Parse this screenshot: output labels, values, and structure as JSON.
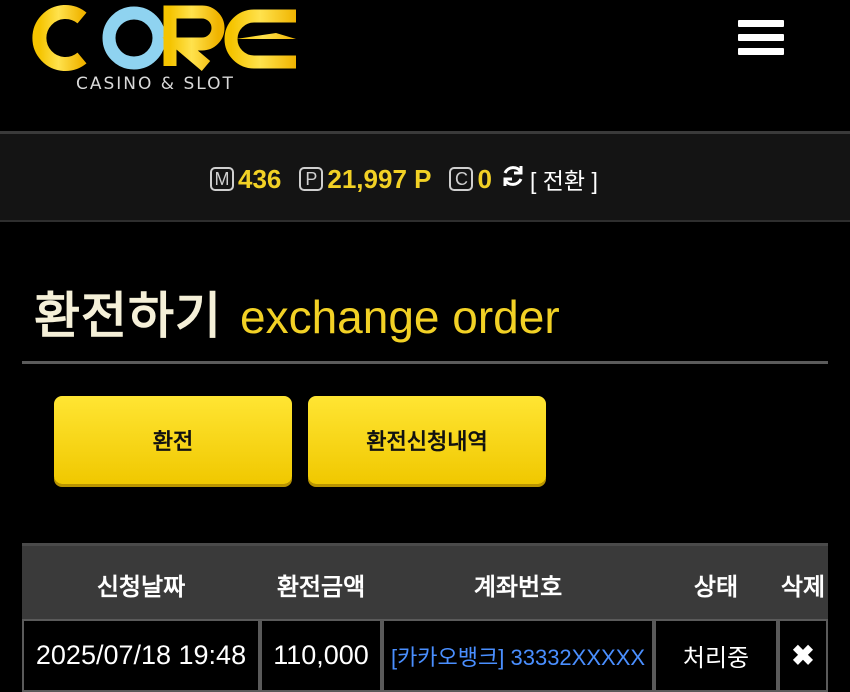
{
  "header": {
    "logo_text": "CORE",
    "logo_sub": "CASINO & SLOT",
    "menu_icon": "hamburger-icon"
  },
  "balance": {
    "m_badge": "M",
    "m_value": "436",
    "p_badge": "P",
    "p_value": "21,997 P",
    "c_badge": "C",
    "c_value": "0",
    "refresh_icon": "refresh-icon",
    "convert_label": "[ 전환 ]"
  },
  "page": {
    "title_ko": "환전하기",
    "title_en": "exchange order"
  },
  "actions": {
    "exchange_label": "환전",
    "history_label": "환전신청내역"
  },
  "table": {
    "columns": [
      "신청날짜",
      "환전금액",
      "계좌번호",
      "상태",
      "삭제"
    ],
    "rows": [
      {
        "date": "2025/07/18 19:48",
        "amount": "110,000",
        "account": "[카카오뱅크] 33332XXXXX",
        "status": "처리중",
        "delete_icon": "close-icon"
      }
    ]
  },
  "colors": {
    "accent": "#f2d125",
    "background": "#000000",
    "link": "#4a8fff"
  }
}
